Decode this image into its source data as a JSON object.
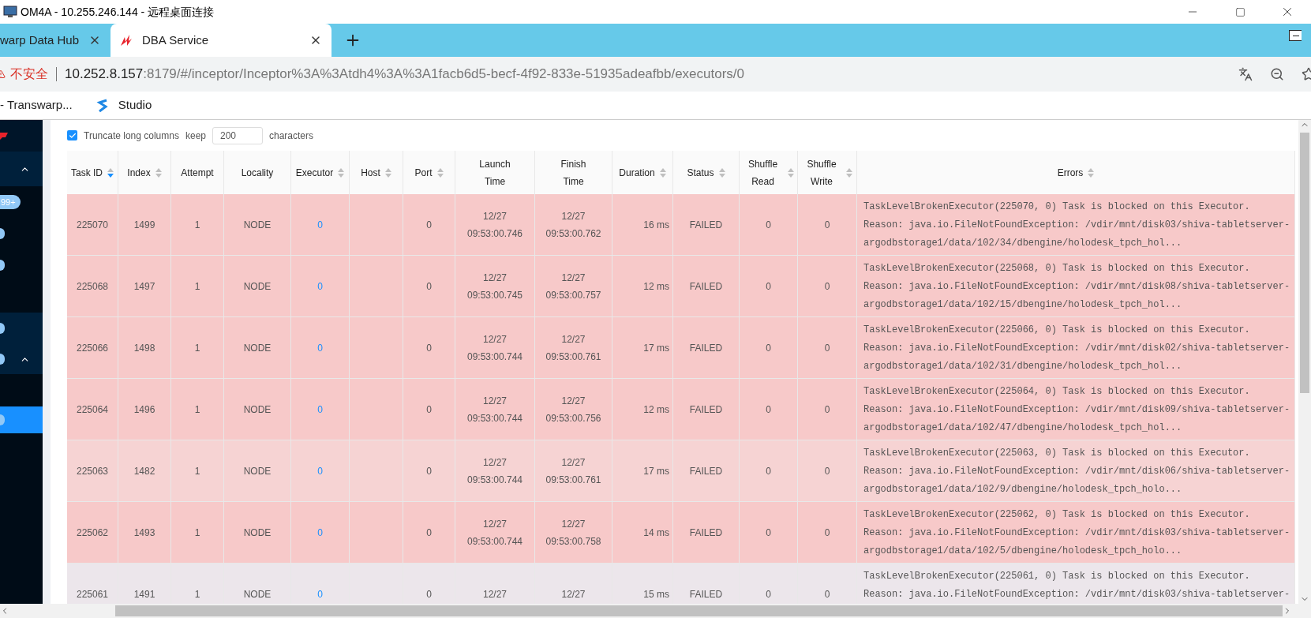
{
  "window": {
    "title": "OM4A - 10.255.246.144 - 远程桌面连接"
  },
  "browser": {
    "tabs": [
      {
        "label": "warp Data Hub",
        "selected": false
      },
      {
        "label": "DBA Service",
        "selected": true
      }
    ],
    "address": {
      "security": "不安全",
      "host": "10.252.8.157",
      "path": ":8179/#/inceptor/Inceptor%3A%3Atdh4%3A%3A1facb6d5-becf-4f92-833e-51935adeafbb/executors/0"
    },
    "bookmarks": [
      "- Transwarp...",
      "Studio"
    ]
  },
  "sidebar": {
    "badge": "99+"
  },
  "options": {
    "truncate": true,
    "label": "Truncate long columns",
    "keep": "keep",
    "value": "200",
    "unit": "characters"
  },
  "table": {
    "columns": [
      {
        "label": "Task ID",
        "sortable": true,
        "sorted": true,
        "kind": "text"
      },
      {
        "label": "Index",
        "sortable": true,
        "sorted": false,
        "kind": "text"
      },
      {
        "label": "Attempt",
        "sortable": false,
        "kind": "text"
      },
      {
        "label": "Locality",
        "sortable": false,
        "kind": "text"
      },
      {
        "label": "Executor",
        "sortable": true,
        "sorted": false,
        "kind": "link"
      },
      {
        "label": "Host",
        "sortable": true,
        "sorted": false,
        "kind": "text"
      },
      {
        "label": "Port",
        "sortable": true,
        "sorted": false,
        "kind": "text"
      },
      {
        "label": "Launch Time",
        "sortable": false,
        "kind": "text"
      },
      {
        "label": "Finish Time",
        "sortable": false,
        "kind": "text"
      },
      {
        "label": "Duration",
        "sortable": true,
        "sorted": false,
        "kind": "right"
      },
      {
        "label": "Status",
        "sortable": true,
        "sorted": false,
        "kind": "text"
      },
      {
        "label": "Shuffle Read",
        "sortable": true,
        "sorted": false,
        "kind": "text"
      },
      {
        "label": "Shuffle Write",
        "sortable": true,
        "sorted": false,
        "kind": "text"
      },
      {
        "label": "Errors",
        "sortable": true,
        "sorted": false,
        "kind": "code"
      }
    ],
    "rows": [
      {
        "kind": "failed",
        "cells": [
          "225070",
          "1499",
          "1",
          "NODE",
          "0",
          "",
          "0",
          "12/27 09:53:00.746",
          "12/27 09:53:00.762",
          "16 ms",
          "FAILED",
          "0",
          "0",
          "TaskLevelBrokenExecutor(225070, 0) Task is blocked on this Executor. Reason: java.io.FileNotFoundException: /vdir/mnt/disk03/shiva-tabletserver-argodbstorage1/data/102/34/dbengine/holodesk_tpch_hol..."
        ]
      },
      {
        "kind": "failed",
        "cells": [
          "225068",
          "1497",
          "1",
          "NODE",
          "0",
          "",
          "0",
          "12/27 09:53:00.745",
          "12/27 09:53:00.757",
          "12 ms",
          "FAILED",
          "0",
          "0",
          "TaskLevelBrokenExecutor(225068, 0) Task is blocked on this Executor. Reason: java.io.FileNotFoundException: /vdir/mnt/disk08/shiva-tabletserver-argodbstorage1/data/102/15/dbengine/holodesk_tpch_hol..."
        ]
      },
      {
        "kind": "failed",
        "cells": [
          "225066",
          "1498",
          "1",
          "NODE",
          "0",
          "",
          "0",
          "12/27 09:53:00.744",
          "12/27 09:53:00.761",
          "17 ms",
          "FAILED",
          "0",
          "0",
          "TaskLevelBrokenExecutor(225066, 0) Task is blocked on this Executor. Reason: java.io.FileNotFoundException: /vdir/mnt/disk02/shiva-tabletserver-argodbstorage1/data/102/31/dbengine/holodesk_tpch_hol..."
        ]
      },
      {
        "kind": "failed",
        "cells": [
          "225064",
          "1496",
          "1",
          "NODE",
          "0",
          "",
          "0",
          "12/27 09:53:00.744",
          "12/27 09:53:00.756",
          "12 ms",
          "FAILED",
          "0",
          "0",
          "TaskLevelBrokenExecutor(225064, 0) Task is blocked on this Executor. Reason: java.io.FileNotFoundException: /vdir/mnt/disk09/shiva-tabletserver-argodbstorage1/data/102/47/dbengine/holodesk_tpch_hol..."
        ]
      },
      {
        "kind": "failed-light",
        "cells": [
          "225063",
          "1482",
          "1",
          "NODE",
          "0",
          "",
          "0",
          "12/27 09:53:00.744",
          "12/27 09:53:00.761",
          "17 ms",
          "FAILED",
          "0",
          "0",
          "TaskLevelBrokenExecutor(225063, 0) Task is blocked on this Executor. Reason: java.io.FileNotFoundException: /vdir/mnt/disk06/shiva-tabletserver-argodbstorage1/data/102/9/dbengine/holodesk_tpch_holo..."
        ]
      },
      {
        "kind": "failed",
        "cells": [
          "225062",
          "1493",
          "1",
          "NODE",
          "0",
          "",
          "0",
          "12/27 09:53:00.744",
          "12/27 09:53:00.758",
          "14 ms",
          "FAILED",
          "0",
          "0",
          "TaskLevelBrokenExecutor(225062, 0) Task is blocked on this Executor. Reason: java.io.FileNotFoundException: /vdir/mnt/disk03/shiva-tabletserver-argodbstorage1/data/102/5/dbengine/holodesk_tpch_holo..."
        ]
      },
      {
        "kind": "neutral",
        "cells": [
          "225061",
          "1491",
          "1",
          "NODE",
          "0",
          "",
          "0",
          "12/27",
          "12/27",
          "15 ms",
          "FAILED",
          "0",
          "0",
          "TaskLevelBrokenExecutor(225061, 0) Task is blocked on this Executor. Reason: java.io.FileNotFoundException: /vdir/mnt/disk03/shiva-tabletserver-"
        ]
      }
    ]
  }
}
